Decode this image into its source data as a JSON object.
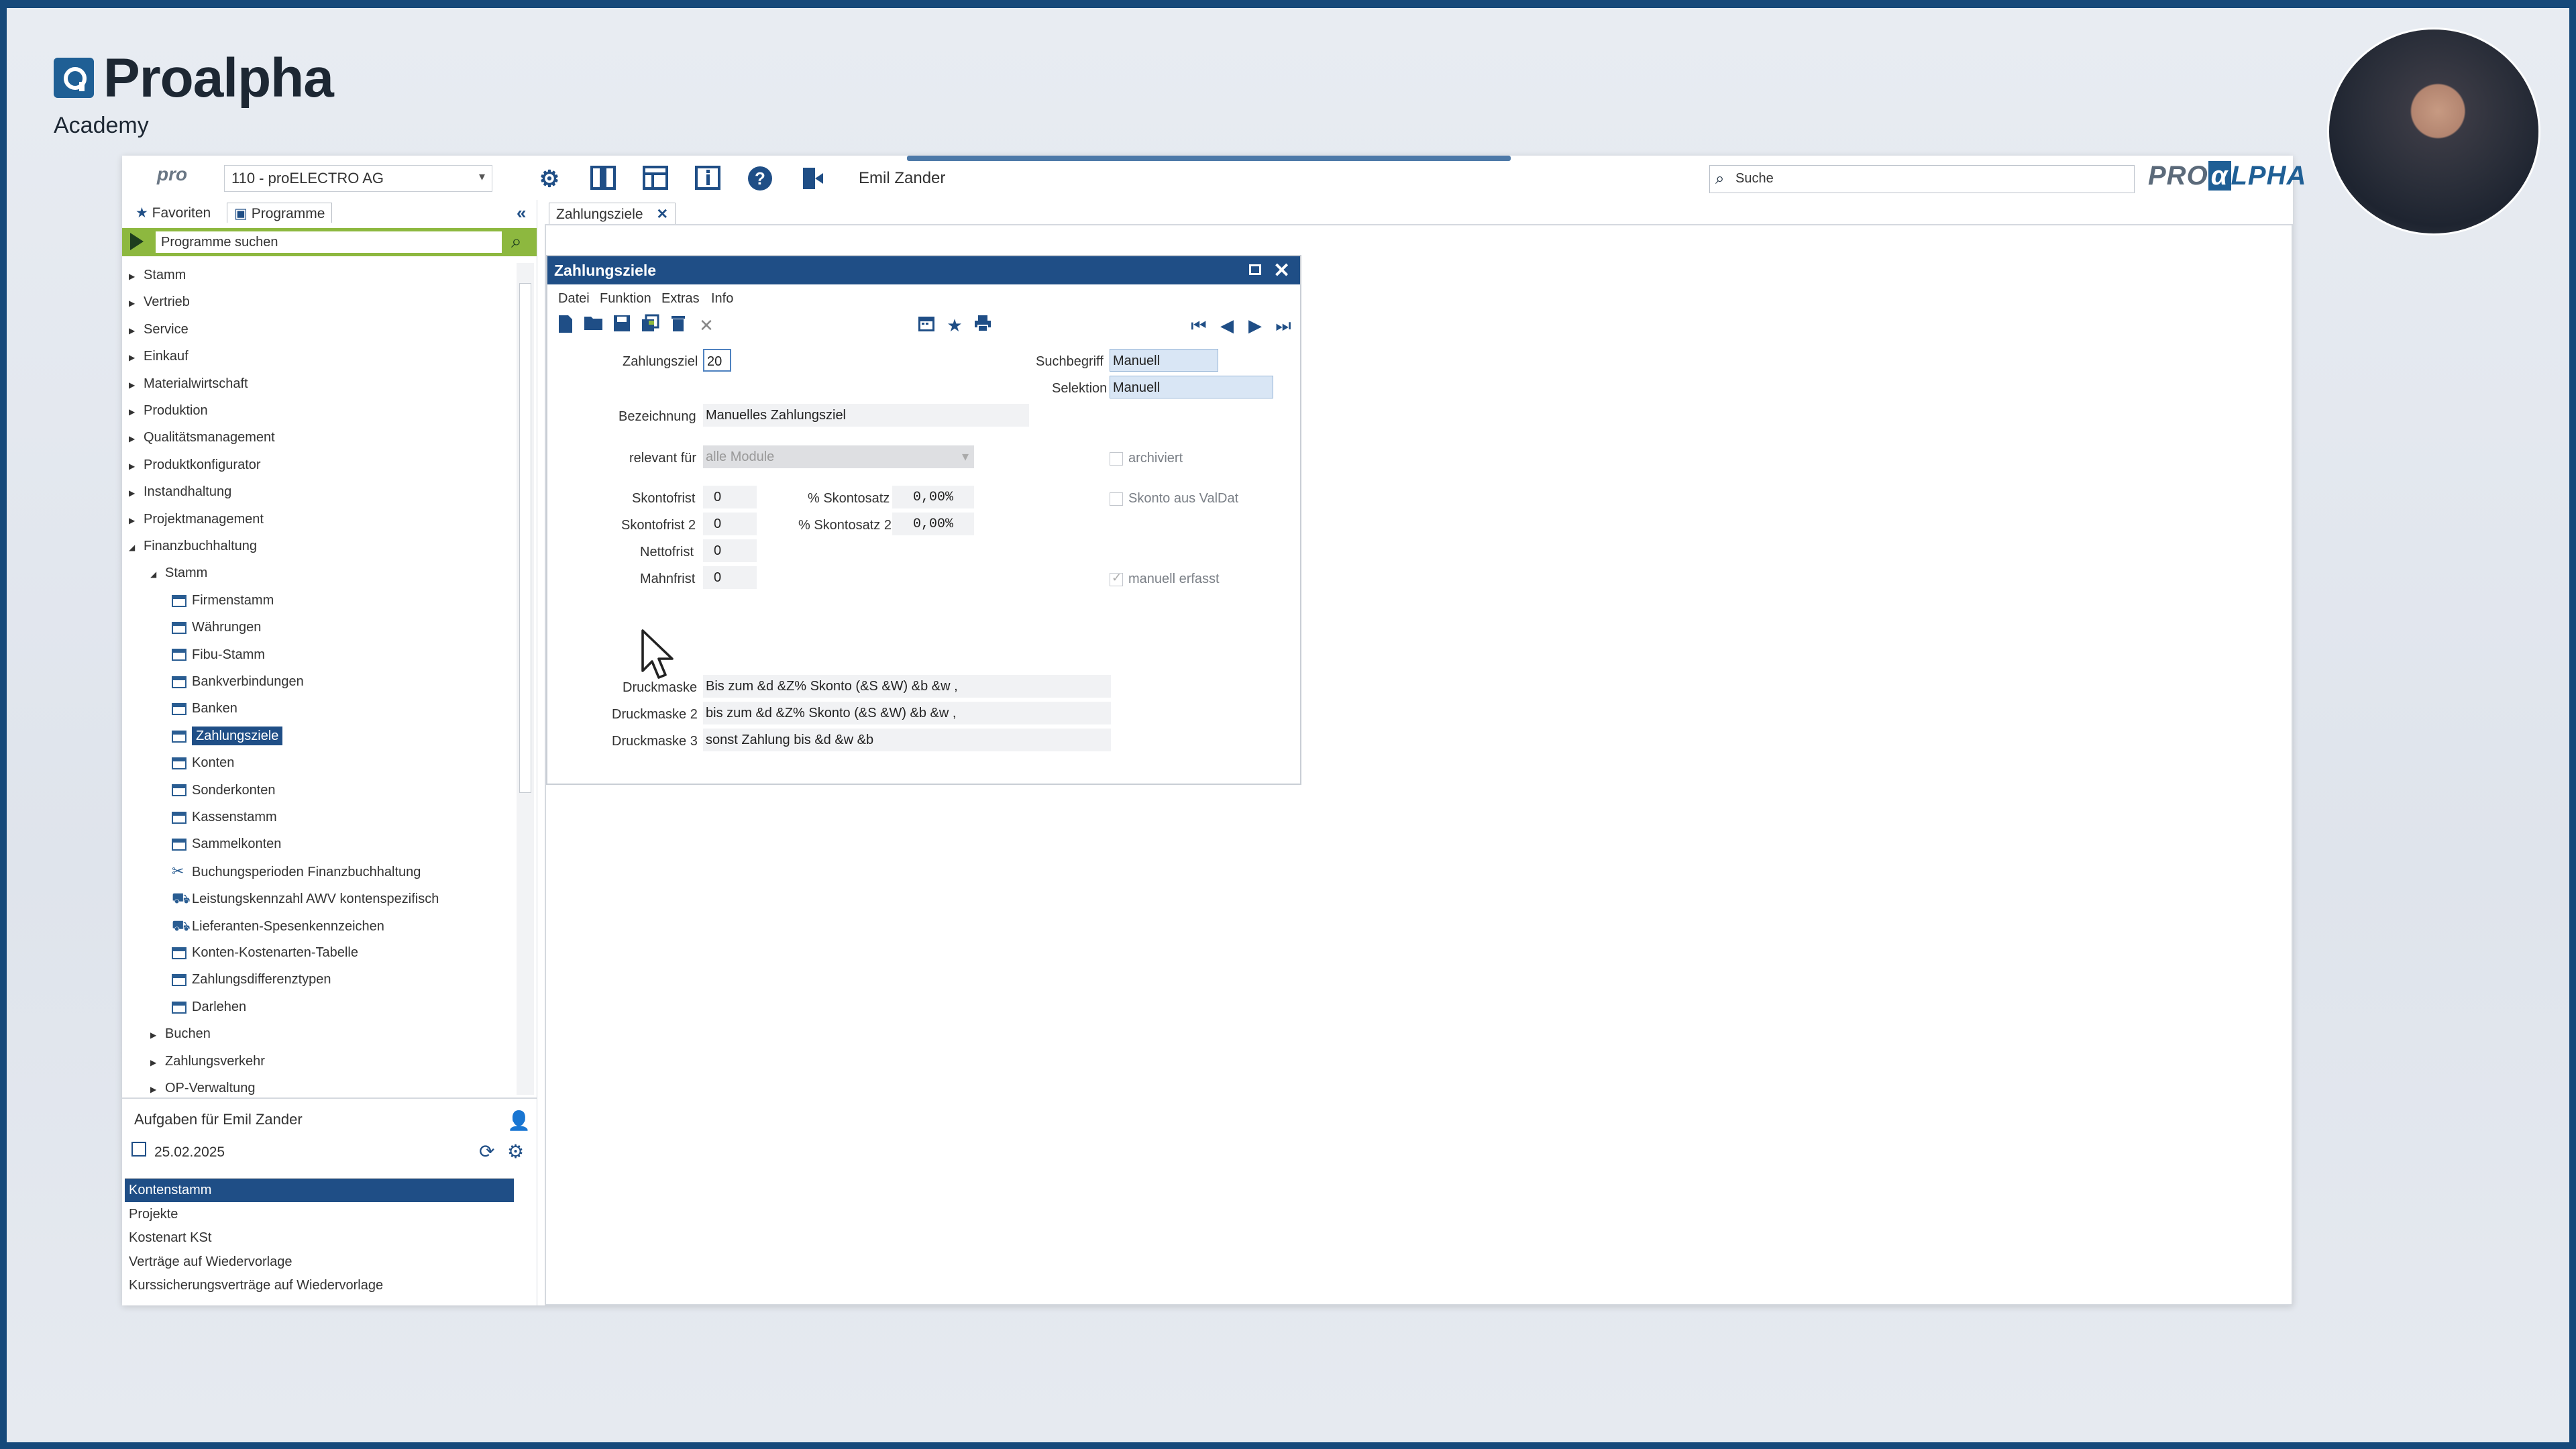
{
  "brand": {
    "name": "Proalpha",
    "sub": "Academy"
  },
  "topbar": {
    "pro_logo": "pro",
    "company": "110 - proELECTRO AG",
    "user": "Emil Zander",
    "search_placeholder": "Suche",
    "logo_text_a": "PRO",
    "logo_text_b": "α",
    "logo_text_c": "LPHA"
  },
  "left_tabs": {
    "favorites": "Favoriten",
    "programs": "Programme"
  },
  "program_search": {
    "placeholder": "Programme suchen"
  },
  "tree": [
    {
      "label": "Stamm",
      "level": 0,
      "expanded": false,
      "kind": "folder"
    },
    {
      "label": "Vertrieb",
      "level": 0,
      "expanded": false,
      "kind": "folder"
    },
    {
      "label": "Service",
      "level": 0,
      "expanded": false,
      "kind": "folder"
    },
    {
      "label": "Einkauf",
      "level": 0,
      "expanded": false,
      "kind": "folder"
    },
    {
      "label": "Materialwirtschaft",
      "level": 0,
      "expanded": false,
      "kind": "folder"
    },
    {
      "label": "Produktion",
      "level": 0,
      "expanded": false,
      "kind": "folder"
    },
    {
      "label": "Qualitätsmanagement",
      "level": 0,
      "expanded": false,
      "kind": "folder"
    },
    {
      "label": "Produktkonfigurator",
      "level": 0,
      "expanded": false,
      "kind": "folder"
    },
    {
      "label": "Instandhaltung",
      "level": 0,
      "expanded": false,
      "kind": "folder"
    },
    {
      "label": "Projektmanagement",
      "level": 0,
      "expanded": false,
      "kind": "folder"
    },
    {
      "label": "Finanzbuchhaltung",
      "level": 0,
      "expanded": true,
      "kind": "folder"
    },
    {
      "label": "Stamm",
      "level": 1,
      "expanded": true,
      "kind": "folder"
    },
    {
      "label": "Firmenstamm",
      "level": 2,
      "kind": "window"
    },
    {
      "label": "Währungen",
      "level": 2,
      "kind": "window"
    },
    {
      "label": "Fibu-Stamm",
      "level": 2,
      "kind": "window"
    },
    {
      "label": "Bankverbindungen",
      "level": 2,
      "kind": "window"
    },
    {
      "label": "Banken",
      "level": 2,
      "kind": "window"
    },
    {
      "label": "Zahlungsziele",
      "level": 2,
      "kind": "window",
      "selected": true
    },
    {
      "label": "Konten",
      "level": 2,
      "kind": "window"
    },
    {
      "label": "Sonderkonten",
      "level": 2,
      "kind": "window"
    },
    {
      "label": "Kassenstamm",
      "level": 2,
      "kind": "window"
    },
    {
      "label": "Sammelkonten",
      "level": 2,
      "kind": "window"
    },
    {
      "label": "Buchungsperioden Finanzbuchhaltung",
      "level": 2,
      "kind": "tool"
    },
    {
      "label": "Leistungskennzahl AWV kontenspezifisch",
      "level": 2,
      "kind": "tool2"
    },
    {
      "label": "Lieferanten-Spesenkennzeichen",
      "level": 2,
      "kind": "tool2"
    },
    {
      "label": "Konten-Kostenarten-Tabelle",
      "level": 2,
      "kind": "window"
    },
    {
      "label": "Zahlungsdifferenztypen",
      "level": 2,
      "kind": "window"
    },
    {
      "label": "Darlehen",
      "level": 2,
      "kind": "window"
    },
    {
      "label": "Buchen",
      "level": 1,
      "expanded": false,
      "kind": "folder"
    },
    {
      "label": "Zahlungsverkehr",
      "level": 1,
      "expanded": false,
      "kind": "folder"
    },
    {
      "label": "OP-Verwaltung",
      "level": 1,
      "expanded": false,
      "kind": "folder"
    }
  ],
  "tasks": {
    "title": "Aufgaben für Emil Zander",
    "date": "25.02.2025",
    "items": [
      "Kontenstamm",
      "Projekte",
      "Kostenart KSt",
      "Verträge auf Wiedervorlage",
      "Kurssicherungsverträge auf Wiedervorlage"
    ]
  },
  "main_tab": {
    "label": "Zahlungsziele"
  },
  "dialog": {
    "title": "Zahlungsziele",
    "menu": [
      "Datei",
      "Funktion",
      "Extras",
      "Info"
    ],
    "fields": {
      "zahlungsziel_label": "Zahlungsziel",
      "zahlungsziel_value": "20",
      "suchbegriff_label": "Suchbegriff",
      "suchbegriff_value": "Manuell",
      "selektion_label": "Selektion",
      "selektion_value": "Manuell",
      "bezeichnung_label": "Bezeichnung",
      "bezeichnung_value": "Manuelles Zahlungsziel",
      "relevant_label": "relevant für",
      "relevant_value": "alle Module",
      "archiviert_label": "archiviert",
      "skontofrist_label": "Skontofrist",
      "skontofrist_value": "0",
      "skontosatz_label": "% Skontosatz",
      "skontosatz_value": "0,00%",
      "skonto_valdat_label": "Skonto aus ValDat",
      "skontofrist2_label": "Skontofrist 2",
      "skontofrist2_value": "0",
      "skontosatz2_label": "% Skontosatz 2",
      "skontosatz2_value": "0,00%",
      "nettofrist_label": "Nettofrist",
      "nettofrist_value": "0",
      "mahnfrist_label": "Mahnfrist",
      "mahnfrist_value": "0",
      "manuell_label": "manuell erfasst",
      "druckmaske_label": "Druckmaske",
      "druckmaske_value": "Bis zum &d &Z% Skonto (&S &W) &b &w ,",
      "druckmaske2_label": "Druckmaske 2",
      "druckmaske2_value": "bis zum &d &Z% Skonto (&S &W) &b &w ,",
      "druckmaske3_label": "Druckmaske 3",
      "druckmaske3_value": "sonst Zahlung bis &d &w &b"
    }
  },
  "icons": {
    "settings": "gear-icon",
    "layout1": "panel-icon",
    "layout2": "layout-icon",
    "help": "help-icon",
    "exit": "exit-icon"
  }
}
